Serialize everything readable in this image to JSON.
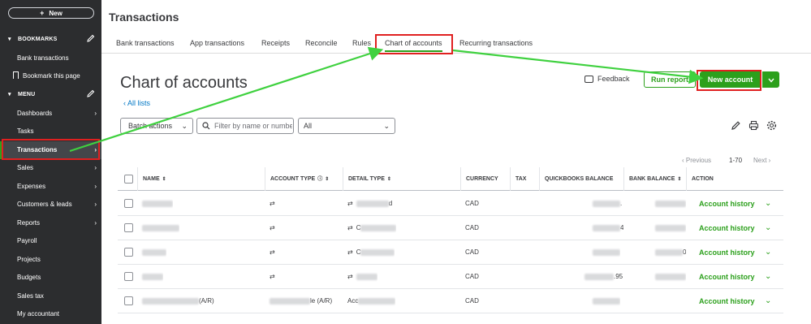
{
  "sidebar": {
    "new_label": "New",
    "bookmarks_label": "BOOKMARKS",
    "bookmark_items": [
      "Bank transactions",
      "Bookmark this page"
    ],
    "menu_label": "MENU",
    "menu_items": [
      "Dashboards",
      "Tasks",
      "Transactions",
      "Sales",
      "Expenses",
      "Customers & leads",
      "Reports",
      "Payroll",
      "Projects",
      "Budgets",
      "Sales tax",
      "My accountant"
    ]
  },
  "header": {
    "title": "Transactions"
  },
  "tabs": [
    "Bank transactions",
    "App transactions",
    "Receipts",
    "Reconcile",
    "Rules",
    "Chart of accounts",
    "Recurring transactions"
  ],
  "page": {
    "title": "Chart of accounts",
    "all_lists": "All lists",
    "feedback": "Feedback",
    "run_report": "Run report",
    "new_account": "New account"
  },
  "filters": {
    "batch_actions": "Batch actions",
    "search_placeholder": "Filter by name or number",
    "type_select": "All"
  },
  "pagination": {
    "previous": "Previous",
    "range": "1-70",
    "next": "Next"
  },
  "table": {
    "headers": [
      "NAME",
      "ACCOUNT TYPE",
      "DETAIL TYPE",
      "CURRENCY",
      "TAX",
      "QUICKBOOKS BALANCE",
      "BANK BALANCE",
      "ACTION"
    ],
    "rows": [
      {
        "name": "",
        "detail": "d",
        "currency": "CAD",
        "qb_balance": ".",
        "bank_balance": "",
        "action": "Account history"
      },
      {
        "name": "",
        "detail": "C",
        "currency": "CAD",
        "qb_balance": "4",
        "bank_balance": "",
        "action": "Account history"
      },
      {
        "name": "",
        "detail": "C",
        "currency": "CAD",
        "qb_balance": "",
        "bank_balance": "0",
        "action": "Account history"
      },
      {
        "name": "",
        "detail": "",
        "currency": "CAD",
        "qb_balance": ".95",
        "bank_balance": "",
        "action": "Account history"
      },
      {
        "name": "(A/R)",
        "account_type": "le (A/R)",
        "detail": "Acc",
        "currency": "CAD",
        "qb_balance": "",
        "bank_balance": "",
        "action": "Account history"
      }
    ]
  },
  "colors": {
    "brand_green": "#2ca01c",
    "sidebar_bg": "#2c2d2f",
    "annotation_red": "#e02020",
    "arrow_green": "#3fd13f",
    "link_blue": "#0077c5"
  },
  "icons": [
    "pencil-icon",
    "bookmark-icon",
    "chevron-right-icon",
    "feedback-icon",
    "search-icon",
    "edit-icon",
    "print-icon",
    "settings-icon",
    "sort-icon",
    "info-icon",
    "transfer-icon",
    "chevron-down-icon"
  ]
}
